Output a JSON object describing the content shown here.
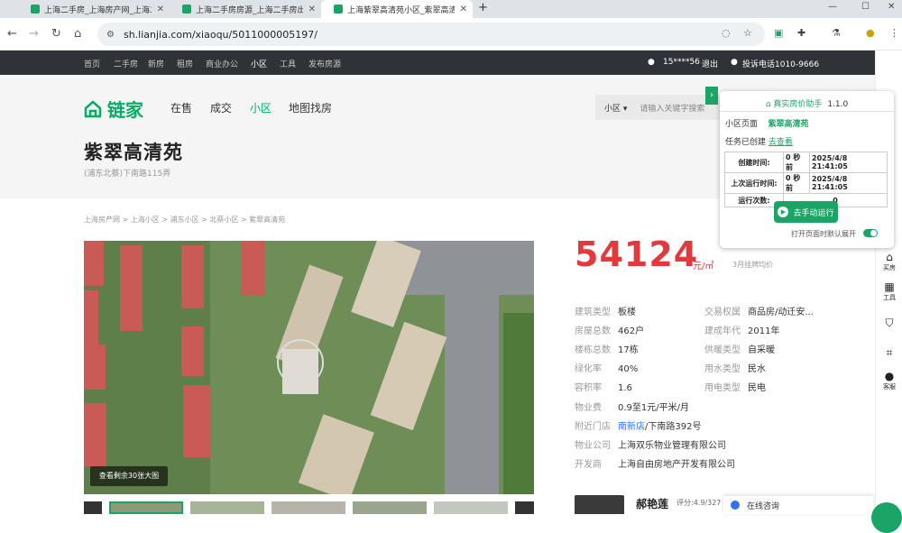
{
  "browser": {
    "tabs": [
      {
        "label": "上海二手房_上海房产网_上海二手",
        "active": false
      },
      {
        "label": "上海二手房房源_上海二手房出售",
        "active": false
      },
      {
        "label": "上海紫翠高清苑小区_紫翠高清苑",
        "active": true
      }
    ],
    "url": "sh.lianjia.com/xiaoqu/5011000005197/"
  },
  "topnav": {
    "items": [
      "首页",
      "二手房",
      "新房",
      "租房",
      "商业办公",
      "小区",
      "工具",
      "发布房源"
    ],
    "current": "小区",
    "user": "15****56",
    "logout": "退出",
    "hotline": "投诉电话1010-9666"
  },
  "header": {
    "logo": "链家",
    "nav": [
      "在售",
      "成交",
      "小区",
      "地图找房"
    ],
    "nav_current": "小区",
    "search_select": "小区",
    "search_placeholder": "请输入关键字搜索",
    "title": "紫翠高清苑",
    "subtitle": "(浦东北蔡)下南路115弄"
  },
  "breadcrumb": "上海房产网 > 上海小区 > 浦东小区 > 北蔡小区 > 紫翠高清苑",
  "photo": {
    "button": "查看剩余30张大图"
  },
  "price": {
    "value": "54124",
    "unit": "元/㎡",
    "note": "3月挂牌均价"
  },
  "info_left": [
    {
      "k": "建筑类型",
      "v": "板楼"
    },
    {
      "k": "房屋总数",
      "v": "462户"
    },
    {
      "k": "楼栋总数",
      "v": "17栋"
    },
    {
      "k": "绿化率",
      "v": "40%"
    },
    {
      "k": "容积率",
      "v": "1.6"
    }
  ],
  "info_right": [
    {
      "k": "交易权属",
      "v": "商品房/动迁安..."
    },
    {
      "k": "建成年代",
      "v": "2011年"
    },
    {
      "k": "供暖类型",
      "v": "自采暖"
    },
    {
      "k": "用水类型",
      "v": "民水"
    },
    {
      "k": "用电类型",
      "v": "民电"
    }
  ],
  "info_full": [
    {
      "k": "物业费",
      "v": "0.9至1元/平米/月"
    },
    {
      "k": "附近门店",
      "v_link": "南新店",
      "v": "/下南路392号"
    },
    {
      "k": "物业公司",
      "v": "上海双乐物业管理有限公司"
    },
    {
      "k": "开发商",
      "v": "上海自由房地产开发有限公司"
    }
  ],
  "agent": {
    "name": "郝艳莲",
    "score": "评分:4.9/327"
  },
  "sidebar": [
    {
      "icon": "home-icon",
      "label": "买房"
    },
    {
      "icon": "grid-icon",
      "label": "工具"
    },
    {
      "icon": "shield-icon",
      "label": ""
    },
    {
      "icon": "scan-icon",
      "label": ""
    },
    {
      "icon": "chat-icon",
      "label": "客服"
    }
  ],
  "panel": {
    "title": "真实房价助手",
    "version": "1.1.0",
    "page_label": "小区页面",
    "page_value": "紫翠高清苑",
    "task_label": "任务已创建",
    "task_link": "去查看",
    "rows": [
      {
        "k": "创建时间:",
        "v1": "0 秒前",
        "v2": "2025/4/8 21:41:05"
      },
      {
        "k": "上次运行时间:",
        "v1": "0 秒前",
        "v2": "2025/4/8 21:41:05"
      },
      {
        "k": "运行次数:",
        "v1": "0",
        "v2": ""
      }
    ],
    "run_button": "去手动运行",
    "footer": "打开页面时默认展开"
  },
  "consult": "在线咨询"
}
